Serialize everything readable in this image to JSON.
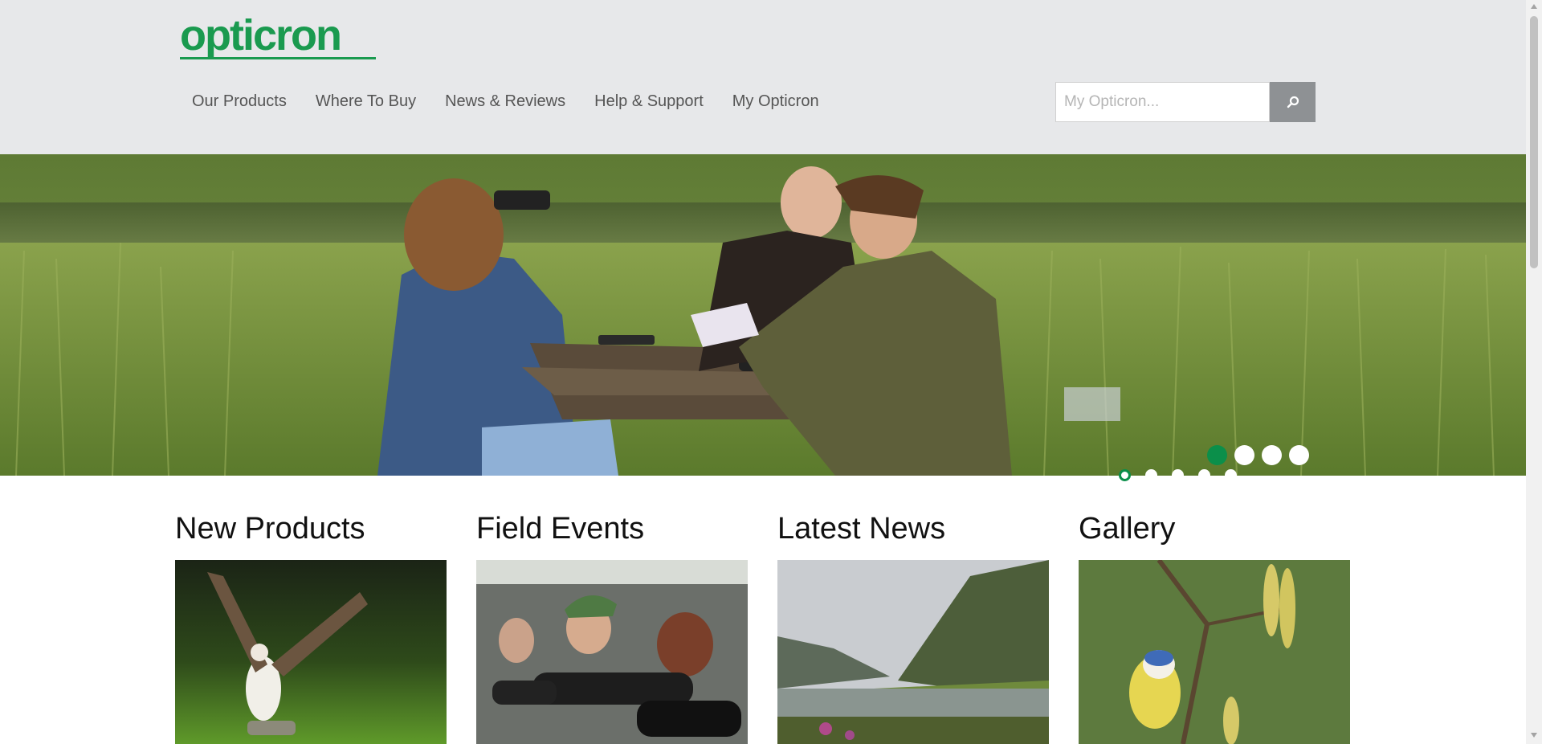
{
  "brand": {
    "logo_text": "opticron",
    "color": "#1a9a4f"
  },
  "nav": {
    "items": [
      {
        "label": "Our Products"
      },
      {
        "label": "Where To Buy"
      },
      {
        "label": "News & Reviews"
      },
      {
        "label": "Help & Support"
      },
      {
        "label": "My Opticron"
      }
    ]
  },
  "search": {
    "placeholder": "My Opticron...",
    "button_icon": "search-icon"
  },
  "hero": {
    "slides_count": 4,
    "active_slide": 1,
    "thumbnail_indicators": 5
  },
  "sections": [
    {
      "title": "New Products",
      "image": "osprey-catching-fish"
    },
    {
      "title": "Field Events",
      "image": "people-using-telescopes"
    },
    {
      "title": "Latest News",
      "image": "mountain-valley-lake"
    },
    {
      "title": "Gallery",
      "image": "blue-tit-on-branch"
    }
  ],
  "colors": {
    "accent": "#0b8f4a",
    "header_bg": "#e7e8ea",
    "search_button": "#8e9194"
  }
}
